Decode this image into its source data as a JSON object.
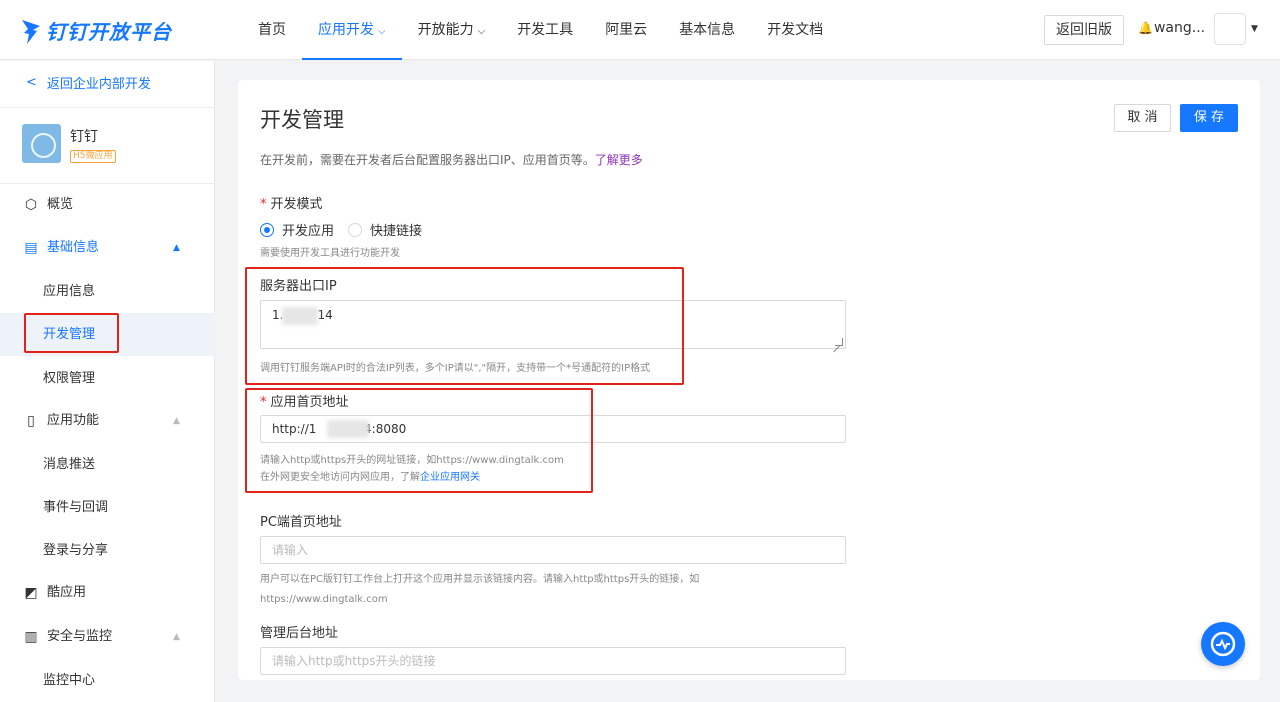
{
  "header": {
    "logo_text": "钉钉开放平台",
    "nav": [
      {
        "label": "首页"
      },
      {
        "label": "应用开发",
        "caret": "⌵"
      },
      {
        "label": "开放能力",
        "caret": "⌵"
      },
      {
        "label": "开发工具"
      },
      {
        "label": "阿里云"
      },
      {
        "label": "基本信息"
      },
      {
        "label": "开发文档"
      }
    ],
    "back_old": "返回旧版",
    "user_name": "wang...",
    "bell": "🔔"
  },
  "sidebar": {
    "back_link": "返回企业内部开发",
    "app_name": "钉钉",
    "app_tag": "H5微应用",
    "menu": {
      "overview": "概览",
      "basic_info": "基础信息",
      "app_info": "应用信息",
      "dev_manage": "开发管理",
      "permission": "权限管理",
      "app_function": "应用功能",
      "message_push": "消息推送",
      "event_callback": "事件与回调",
      "login_share": "登录与分享",
      "cool_app": "酷应用",
      "security": "安全与监控",
      "monitor": "监控中心"
    },
    "active_color": "#1677ff"
  },
  "main": {
    "title": "开发管理",
    "cancel": "取 消",
    "save": "保 存",
    "intro": "在开发前，需要在开发者后台配置服务器出口IP、应用首页等。",
    "intro_link": "了解更多",
    "dev_mode_label": "开发模式",
    "radio_dev_app": "开发应用",
    "radio_quick_link": "快捷链接",
    "dev_mode_hint": "需要使用开发工具进行功能开发",
    "server_ip_label": "服务器出口IP",
    "server_ip_prefix": "1.",
    "server_ip_suffix": "14",
    "server_ip_hint": "调用钉钉服务端API时的合法IP列表，多个IP请以\",\"隔开，支持带一个*号通配符的IP格式",
    "homepage_label": "应用首页地址",
    "homepage_prefix": "http://1",
    "homepage_suffix": "14:8080",
    "homepage_hint1": "请输入http或https开头的网址链接，如https://www.dingtalk.com",
    "homepage_hint2_pre": "在外网更安全地访问内网应用，了解",
    "homepage_hint2_link": "企业应用网关",
    "pc_label": "PC端首页地址",
    "pc_placeholder": "请输入",
    "pc_hint1": "用户可以在PC版钉钉工作台上打开这个应用并显示该链接内容。请输入http或https开头的链接，如",
    "pc_hint2": "https://www.dingtalk.com",
    "admin_label": "管理后台地址",
    "admin_placeholder": "请输入http或https开头的链接"
  },
  "colors": {
    "accent": "#1677ff",
    "highlight_box": "#e2231a",
    "required": "#f5222d",
    "link_purple": "#8f33b5"
  }
}
